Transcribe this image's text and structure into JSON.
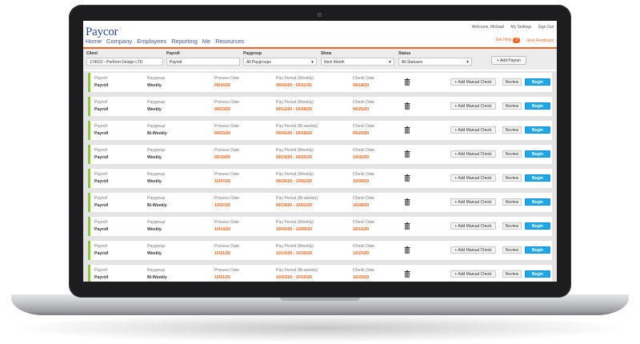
{
  "app": {
    "logo": "Paycor",
    "nav": [
      "Home",
      "Company",
      "Employees",
      "Reporting",
      "Me",
      "Resources"
    ],
    "welcome": "Welcome, Michael",
    "my_settings": "My Settings",
    "sign_out": "Sign Out",
    "get_help": "Get Help",
    "help_count": "3",
    "give_feedback": "Give Feedback"
  },
  "filters": {
    "client": {
      "label": "Client",
      "value": "174022 - Perform Design LTD"
    },
    "payroll": {
      "label": "Payroll",
      "value": "Payroll"
    },
    "paygroup": {
      "label": "Paygroup",
      "value": "All Paygroups"
    },
    "show": {
      "label": "Show",
      "value": "Next Month"
    },
    "status": {
      "label": "Status",
      "value": "All Statuses"
    },
    "add_payrun": "Add Payrun"
  },
  "columns": {
    "payroll": "Payroll",
    "paygroup": "Paygroup",
    "process_date": "Process Date",
    "check_date": "Check Date"
  },
  "actions": {
    "add_manual_check": "Add Manual Check",
    "review": "Review",
    "begin": "Begin"
  },
  "payruns": [
    {
      "payroll": "Payroll",
      "paygroup": "Weekly",
      "period_label": "Pay Period (Weekly)",
      "process_date": "09/16/20",
      "period": "09/05/20 - 09/11/20",
      "check_date": "09/18/20"
    },
    {
      "payroll": "Payroll",
      "paygroup": "Weekly",
      "period_label": "Pay Period (Weekly)",
      "process_date": "09/23/20",
      "period": "09/12/20 - 09/18/20",
      "check_date": "09/25/20"
    },
    {
      "payroll": "Payroll",
      "paygroup": "Bi-Weekly",
      "period_label": "Pay Period (Bi-weekly)",
      "process_date": "09/23/20",
      "period": "09/05/20 - 09/18/20",
      "check_date": "09/25/20"
    },
    {
      "payroll": "Payroll",
      "paygroup": "Weekly",
      "period_label": "Pay Period (Weekly)",
      "process_date": "09/30/20",
      "period": "09/19/20 - 09/25/20",
      "check_date": "10/02/20"
    },
    {
      "payroll": "Payroll",
      "paygroup": "Weekly",
      "period_label": "Pay Period (Weekly)",
      "process_date": "10/07/20",
      "period": "09/26/20 - 10/02/20",
      "check_date": "10/09/20"
    },
    {
      "payroll": "Payroll",
      "paygroup": "Bi-Weekly",
      "period_label": "Pay Period (Bi-weekly)",
      "process_date": "10/07/20",
      "period": "09/19/20 - 10/02/20",
      "check_date": "10/09/20"
    },
    {
      "payroll": "Payroll",
      "paygroup": "Weekly",
      "period_label": "Pay Period (Weekly)",
      "process_date": "10/14/20",
      "period": "10/03/20 - 10/09/20",
      "check_date": "10/16/20"
    },
    {
      "payroll": "Payroll",
      "paygroup": "Weekly",
      "period_label": "Pay Period (Weekly)",
      "process_date": "10/21/20",
      "period": "10/10/20 - 10/16/20",
      "check_date": "10/23/20"
    },
    {
      "payroll": "Payroll",
      "paygroup": "Bi-Weekly",
      "period_label": "Pay Period (Bi-weekly)",
      "process_date": "10/21/20",
      "period": "10/03/20 - 10/16/20",
      "check_date": "10/23/20"
    }
  ],
  "colors": {
    "brand_orange": "#f26722",
    "begin_blue": "#1ea7e8",
    "status_green": "#8cc63e",
    "nav_blue": "#3d5a93"
  }
}
